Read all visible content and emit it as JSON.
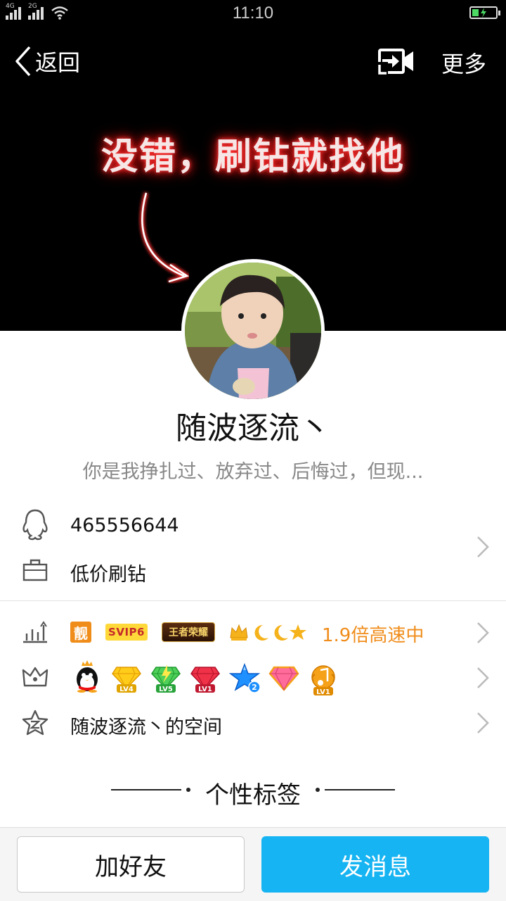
{
  "status_bar": {
    "network_1": "4G",
    "network_2": "2G",
    "time": "11:10"
  },
  "nav": {
    "back_label": "返回",
    "more_label": "更多"
  },
  "cover": {
    "text": "没错，刷钻就找他"
  },
  "profile": {
    "nickname": "随波逐流丶",
    "signature": "你是我挣扎过、放弃过、后悔过，但现..."
  },
  "info": {
    "qq_number": "465556644",
    "occupation": "低价刷钻"
  },
  "vip_row": {
    "badge_liang": "靓",
    "badge_svip": "SVIP6",
    "badge_game": "王者荣耀",
    "speed_text": "1.9倍高速中"
  },
  "privileges": {
    "items": [
      {
        "icon": "qq-penguin-crown"
      },
      {
        "icon": "yellow-diamond",
        "level": "LV4"
      },
      {
        "icon": "green-diamond",
        "level": "LV5"
      },
      {
        "icon": "red-diamond",
        "level": "LV1"
      },
      {
        "icon": "blue-star",
        "level": "2"
      },
      {
        "icon": "pink-diamond"
      },
      {
        "icon": "music-note",
        "level": "LV1"
      }
    ]
  },
  "qzone": {
    "label": "随波逐流丶的空间"
  },
  "tags_section": {
    "title": "个性标签"
  },
  "actions": {
    "add_friend": "加好友",
    "send_message": "发消息"
  },
  "colors": {
    "accent": "#16b4f2",
    "speed_text": "#f08c1a",
    "hero_bg": "#000000"
  }
}
